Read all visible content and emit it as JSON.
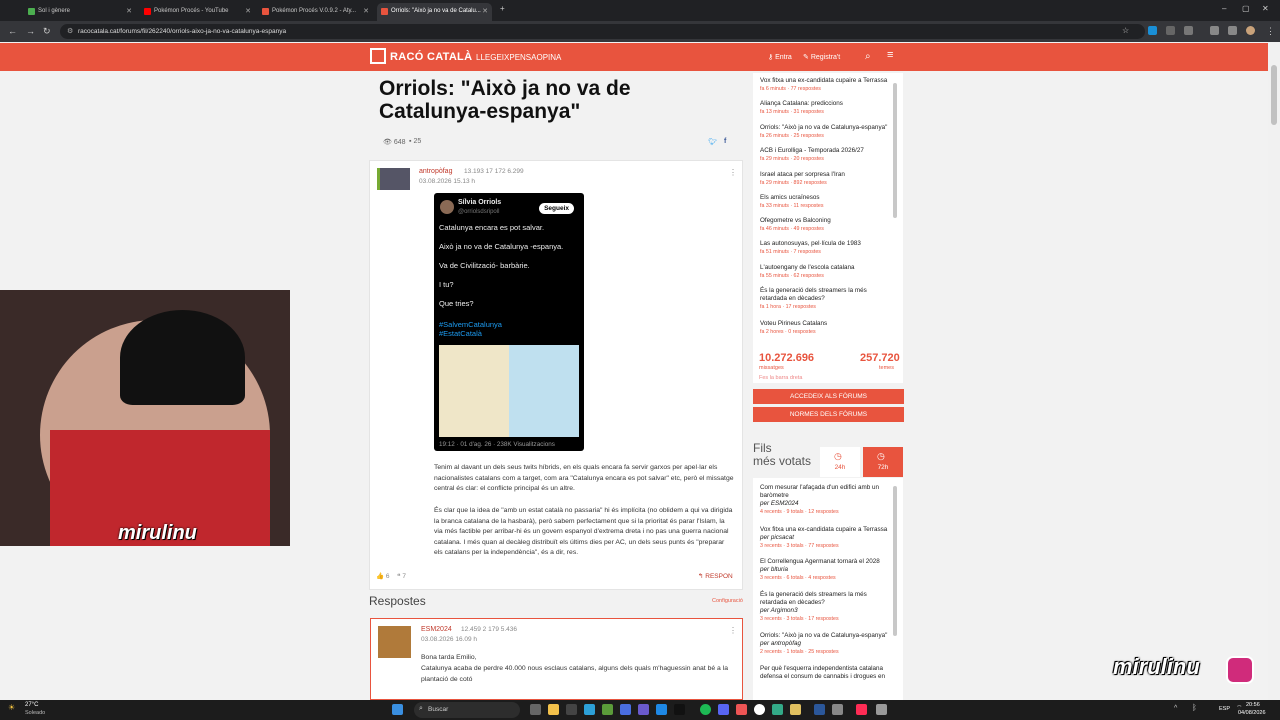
{
  "browser": {
    "tabs": [
      {
        "label": "Sol i gènere"
      },
      {
        "label": "Pokémon Procés - YouTube"
      },
      {
        "label": "Pokémon Procés V.0.9.2 - Aty..."
      },
      {
        "label": "Orriols: \"Això ja no va de Catalu..."
      }
    ],
    "new_tab": "+",
    "url": "racocatala.cat/forums/fil/262240/orriols-aixo-ja-no-va-catalunya-espanya"
  },
  "site": {
    "logo": "RACÓ CATALÀ",
    "tagline": "LLEGEIXPENSAOPINA",
    "login": "Entra",
    "register": "Registra't"
  },
  "thread": {
    "title": "Orriols: \"Això ja no va de Catalunya-espanya\"",
    "views": "648",
    "replies": "25"
  },
  "post": {
    "author": "antropòfag",
    "stats": "13.193   17   172   6.299",
    "date": "03.08.2026 15.13 h",
    "tweet": {
      "name": "Sílvia Orriols",
      "handle": "@orriolsdsripoll",
      "follow": "Segueix",
      "lines": [
        "Catalunya encara es pot salvar.",
        "Això ja no va de Catalunya -espanya.",
        "Va de Civilització- barbàrie.",
        "I tu?",
        "Que tries?"
      ],
      "hashtags": [
        "#SalvemCatalunya",
        "#EstatCatalà"
      ],
      "footer": "19:12 · 01 d'ag. 26 · 238K Visualitzacions"
    },
    "para1": "Tenim al davant un dels seus twits híbrids, en els quals encara fa servir garxos per apel·lar els nacionalistes catalans com a target, com ara \"Catalunya encara es pot salvar\" etc, però el missatge central és clar: el conflicte principal és un altre.",
    "para2": "És clar que la idea de \"amb un estat català no passaria\" hi és implícita (no oblidem a qui va dirigida la branca catalana de la hasbarà), però sabem perfectament que si la prioritat és parar l'Islam, la via més factible per arribar-hi és un govern espanyol d'extrema dreta i no pas una guerra nacional catalana. I més quan al decàleg distribuït els últims dies per AC, un dels seus punts és \"preparar els catalans per la independència\", és a dir, res.",
    "likes": "6",
    "quotes": "7",
    "reply_btn": "RESPON"
  },
  "responses": {
    "title": "Respostes",
    "config": "Configuració",
    "first": {
      "author": "ESM2024",
      "stats": "12.459   2   179   5.436",
      "date": "03.08.2026 16.09 h",
      "line1": "Bona tarda Emilio,",
      "line2": "Catalunya acaba de perdre 40.000 nous esclaus catalans, alguns dels quals m'haguessin anat bé a la plantació de cotó"
    }
  },
  "sidebar": {
    "recent": [
      {
        "title": "Vox fitxa una ex-candidata cupaire a Terrassa",
        "meta": "fa 6 minuts · 77 respostes"
      },
      {
        "title": "Aliança Catalana: prediccions",
        "meta": "fa 13 minuts · 31 respostes"
      },
      {
        "title": "Orriols: \"Això ja no va de Catalunya-espanya\"",
        "meta": "fa 26 minuts · 25 respostes"
      },
      {
        "title": "ACB i Eurolliga - Temporada 2026/27",
        "meta": "fa 29 minuts · 20 respostes"
      },
      {
        "title": "Israel ataca per sorpresa l'Iran",
        "meta": "fa 29 minuts · 892 respostes"
      },
      {
        "title": "Els amics ucraïnesos",
        "meta": "fa 33 minuts · 11 respostes"
      },
      {
        "title": "Ofegometre vs Balconing",
        "meta": "fa 46 minuts · 49 respostes"
      },
      {
        "title": "Las autonosuyas, pel·lícula de 1983",
        "meta": "fa 51 minuts · 7 respostes"
      },
      {
        "title": "L'autoengany de l'escola catalana",
        "meta": "fa 55 minuts · 62 respostes"
      },
      {
        "title": "És la generació dels streamers la més retardada en dècades?",
        "meta": "fa 1 hora · 17 respostes"
      },
      {
        "title": "Voteu Pirineus Catalans",
        "meta": "fa 2 hores · 0 respostes"
      }
    ],
    "messages_count": "10.272.696",
    "messages_label": "missatges",
    "threads_count": "257.720",
    "threads_label": "temes",
    "feed_link": "Fes la barra dreta",
    "access_btn": "ACCEDEIX ALS FÒRUMS",
    "rules_btn": "NORMES DELS FÒRUMS",
    "voted_title_1": "Fils",
    "voted_title_2": "més votats",
    "tab_24": "24h",
    "tab_72": "72h",
    "voted": [
      {
        "title": "Com mesurar l'afaçada d'un edifici amb un baròmetre",
        "by": "per ESM2024",
        "meta": "4 recents · 9 totals · 12 respostes"
      },
      {
        "title": "Vox fitxa una ex-candidata cupaire a Terrassa",
        "by": "per picsacat",
        "meta": "3 recents · 3 totals · 77 respostes"
      },
      {
        "title": "El Correllengua Agermanat tornarà el 2028",
        "by": "per blturia",
        "meta": "3 recents · 6 totals · 4 respostes"
      },
      {
        "title": "És la generació dels streamers la més retardada en dècades?",
        "by": "per Argimon3",
        "meta": "3 recents · 3 totals · 17 respostes"
      },
      {
        "title": "Orriols: \"Això ja no va de Catalunya-espanya\"",
        "by": "per antropòfag",
        "meta": "2 recents · 1 totals · 25 respostes"
      },
      {
        "title": "Per què l'esquerra independentista catalana defensa el consum de cannabis i drogues en",
        "by": "",
        "meta": ""
      }
    ]
  },
  "stream": {
    "brand": "mirulinu"
  },
  "taskbar": {
    "weather_temp": "27°C",
    "weather_desc": "Soleado",
    "search": "Buscar",
    "lang": "ESP",
    "time": "20:56",
    "date": "04/08/2026"
  }
}
